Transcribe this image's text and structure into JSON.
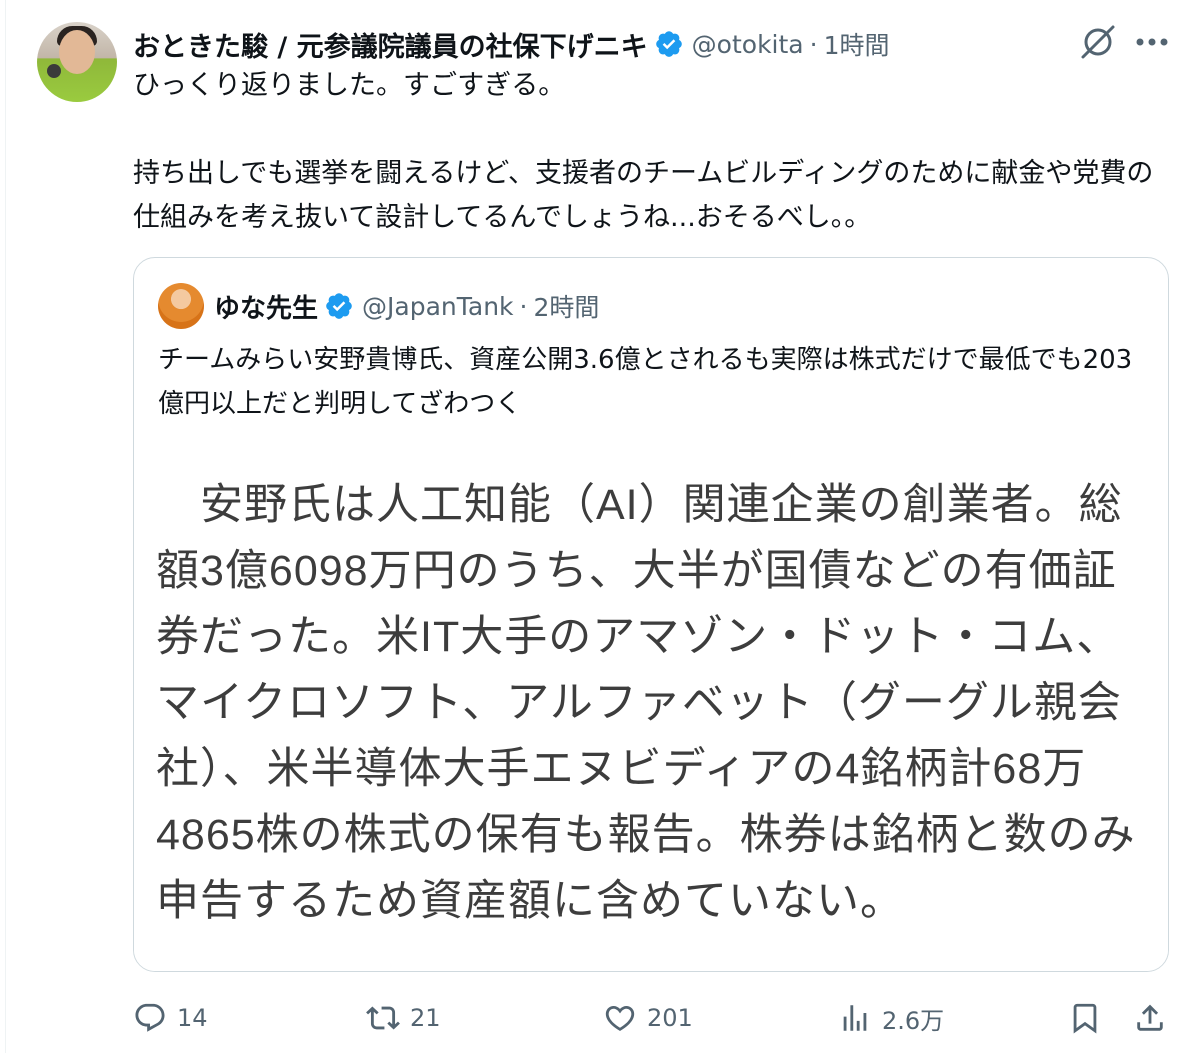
{
  "author": {
    "display_name": "おときた駿 / 元参議院議員の社保下げニキ",
    "handle": "@otokita",
    "separator": "·",
    "time": "1時間"
  },
  "tweet": {
    "line1": "ひっくり返りました。すごすぎる。",
    "line2": "持ち出しでも選挙を闘えるけど、支援者のチームビルディングのために献金や党費の仕組みを考え抜いて設計してるんでしょうね...おそるべし。。"
  },
  "quote": {
    "display_name": "ゆな先生",
    "handle": "@JapanTank",
    "separator": "·",
    "time": "2時間",
    "text": "チームみらい安野貴博氏、資産公開3.6億とされるも実際は株式だけで最低でも203億円以上だと判明してざわつく",
    "image_text": "　安野氏は人工知能（AI）関連企業の創業者。総額3億6098万円のうち、大半が国債などの有価証券だった。米IT大手のアマゾン・ドット・コム、マイクロソフト、アルファベット（グーグル親会社）、米半導体大手エヌビディアの4銘柄計68万4865株の株式の保有も報告。株券は銘柄と数のみ申告するため資産額に含めていない。"
  },
  "actions": {
    "reply_count": "14",
    "retweet_count": "21",
    "like_count": "201",
    "view_count": "2.6万"
  },
  "colors": {
    "text": "#0f1419",
    "secondary": "#536471",
    "verified": "#1d9bf0",
    "border": "#cfd9de"
  }
}
